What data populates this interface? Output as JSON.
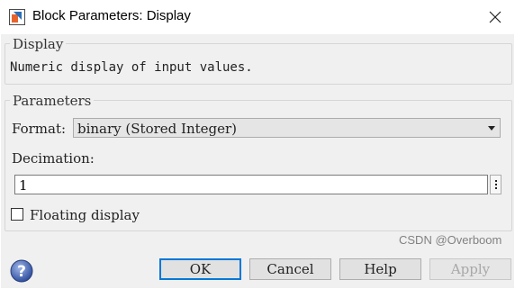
{
  "window": {
    "title": "Block Parameters: Display",
    "icons": {
      "app": "simulink-block-icon",
      "close": "close-icon"
    }
  },
  "description_group": {
    "legend": "Display",
    "text": "Numeric display of input values."
  },
  "parameters_group": {
    "legend": "Parameters",
    "format_label": "Format:",
    "format_value": "binary (Stored Integer)",
    "decimation_label": "Decimation:",
    "decimation_value": "1",
    "floating_label": "Floating display",
    "floating_checked": false
  },
  "buttons": {
    "ok": "OK",
    "cancel": "Cancel",
    "help": "Help",
    "apply": "Apply"
  },
  "watermark": "CSDN @Overboom",
  "colors": {
    "accent": "#0078d7",
    "dialog_bg": "#f0f0f0"
  }
}
